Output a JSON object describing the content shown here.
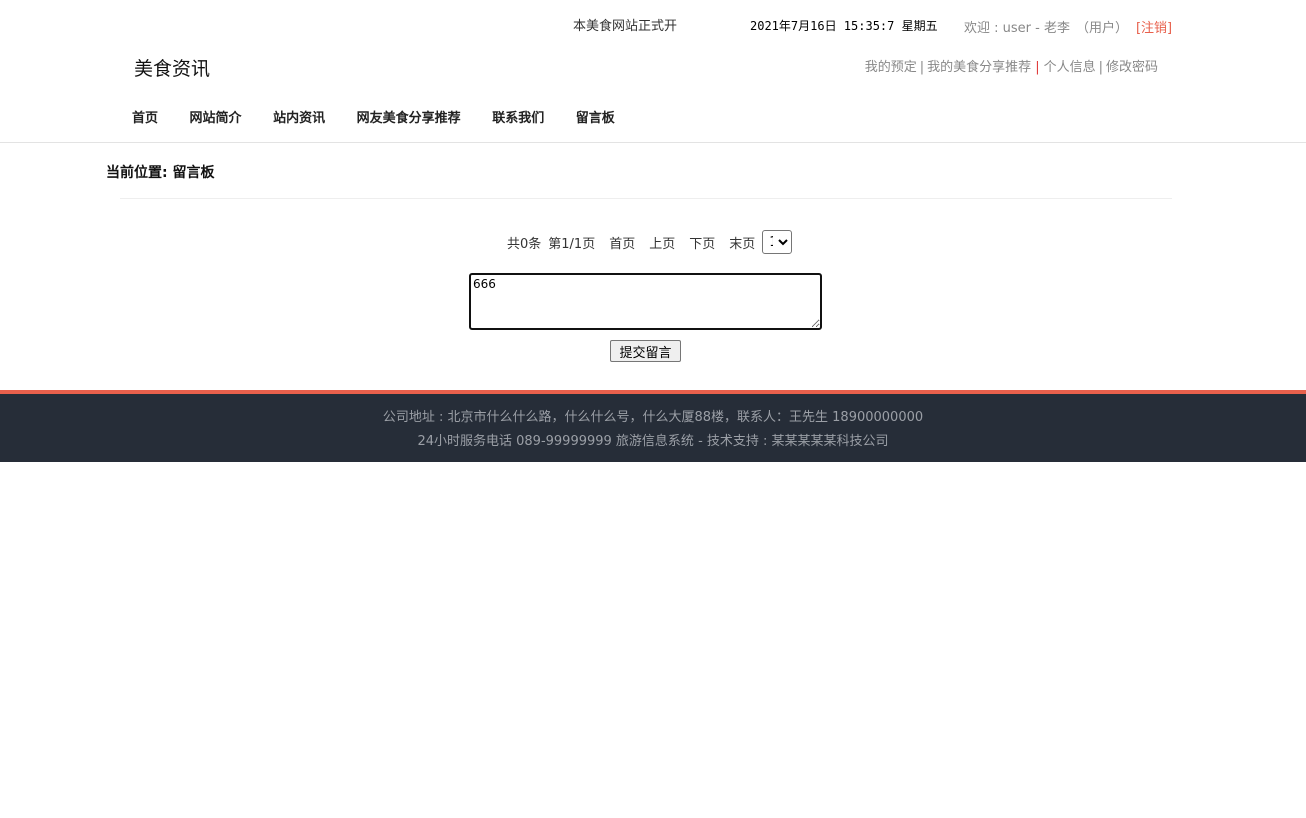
{
  "top": {
    "announcement": "本美食网站正式开",
    "datetime": "2021年7月16日 15:35:7 星期五",
    "welcome_prefix": "欢迎 : user - 老李",
    "role": "（用户）",
    "logout": "[注销]"
  },
  "header": {
    "site_title": "美食资讯",
    "user_links": {
      "my_booking": "我的预定",
      "my_food_share": "我的美食分享推荐",
      "profile": "个人信息",
      "change_password": "修改密码",
      "separator": "|"
    }
  },
  "nav": {
    "items": [
      {
        "label": "首页"
      },
      {
        "label": "网站简介"
      },
      {
        "label": "站内资讯"
      },
      {
        "label": "网友美食分享推荐"
      },
      {
        "label": "联系我们"
      },
      {
        "label": "留言板"
      }
    ]
  },
  "breadcrumb": {
    "text": "当前位置: 留言板"
  },
  "pager": {
    "total": "共0条",
    "page_info": "第1/1页",
    "first": "首页",
    "prev": "上页",
    "next": "下页",
    "last": "末页",
    "selected_page": "1"
  },
  "form": {
    "message_value": "666",
    "submit_label": "提交留言"
  },
  "footer": {
    "line1": "公司地址 : 北京市什么什么路，什么什么号，什么大厦88楼，联系人：王先生 18900000000",
    "line2": "24小时服务电话 089-99999999 旅游信息系统 - 技术支持 : 某某某某某科技公司"
  },
  "colors": {
    "accent": "#e8604c",
    "footer_bg": "#262d38",
    "footer_text": "#9b9fa6",
    "muted_text": "#888888"
  }
}
